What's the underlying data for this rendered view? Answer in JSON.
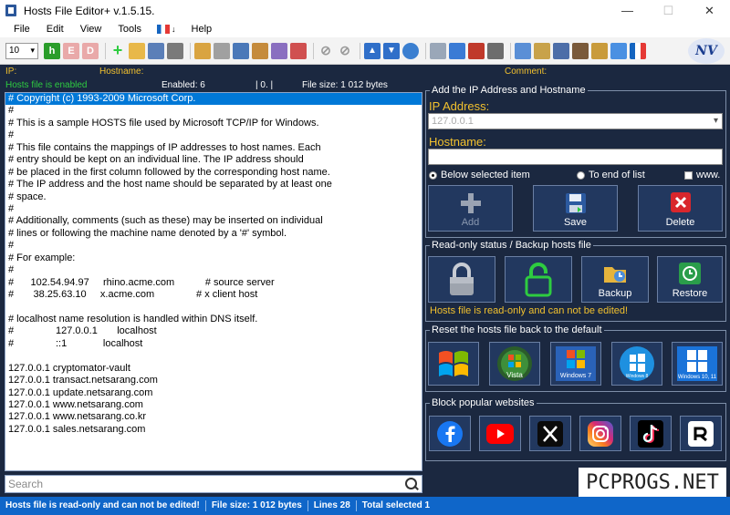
{
  "window": {
    "title": "Hosts File Editor+ v.1.5.15.",
    "min": "—",
    "max": "☐",
    "close": "✕"
  },
  "menu": [
    "File",
    "Edit",
    "View",
    "Tools",
    "Help"
  ],
  "toolbar": {
    "font_size": "10",
    "logo_text": "NV"
  },
  "columns": {
    "ip": "IP:",
    "hostname": "Hostname:",
    "comment": "Comment:"
  },
  "strip": {
    "state": "Hosts file is enabled",
    "enabled": "Enabled: 6",
    "zero": "| 0. |",
    "filesize": "File size: 1 012 bytes"
  },
  "editor_lines": [
    "# Copyright (c) 1993-2009 Microsoft Corp.",
    "#",
    "# This is a sample HOSTS file used by Microsoft TCP/IP for Windows.",
    "#",
    "# This file contains the mappings of IP addresses to host names. Each",
    "# entry should be kept on an individual line. The IP address should",
    "# be placed in the first column followed by the corresponding host name.",
    "# The IP address and the host name should be separated by at least one",
    "# space.",
    "#",
    "# Additionally, comments (such as these) may be inserted on individual",
    "# lines or following the machine name denoted by a '#' symbol.",
    "#",
    "# For example:",
    "#",
    "#      102.54.94.97     rhino.acme.com           # source server",
    "#       38.25.63.10     x.acme.com               # x client host",
    "",
    "# localhost name resolution is handled within DNS itself.",
    "#               127.0.0.1       localhost",
    "#               ::1             localhost",
    "",
    "127.0.0.1 cryptomator-vault",
    "127.0.0.1 transact.netsarang.com",
    "127.0.0.1 update.netsarang.com",
    "127.0.0.1 www.netsarang.com",
    "127.0.0.1 www.netsarang.co.kr",
    "127.0.0.1 sales.netsarang.com"
  ],
  "search": {
    "placeholder": "Search"
  },
  "add_panel": {
    "title": "Add the IP Address  and Hostname",
    "ip_label": "IP Address:",
    "ip_value": "127.0.0.1",
    "host_label": "Hostname:",
    "host_value": "",
    "radio_below": "Below selected item",
    "radio_end": "To end of list",
    "www_label": "www.",
    "add": "Add",
    "save": "Save",
    "delete": "Delete"
  },
  "ro_panel": {
    "title": "Read-only status / Backup hosts file",
    "backup": "Backup",
    "restore": "Restore",
    "message": "Hosts file is read-only and can not be edited!"
  },
  "reset_panel": {
    "title": "Reset the hosts file back to the default",
    "os": [
      "Windows XP",
      "Windows Vista",
      "Windows 7",
      "Windows 8",
      "Windows 10, 11"
    ],
    "labels": {
      "vista": "Vista",
      "w7": "Windows 7",
      "w8": "Windows 8",
      "w10": "Windows 10, 11"
    }
  },
  "block_panel": {
    "title": "Block popular websites",
    "sites": [
      "Facebook",
      "YouTube",
      "X",
      "Instagram",
      "TikTok",
      "Rumble"
    ]
  },
  "statusbar": {
    "msg": "Hosts file is read-only and can not be edited!",
    "filesize": "File size:  1 012 bytes",
    "lines": "Lines 28",
    "total": "Total selected 1"
  },
  "watermark": "PCPROGS.NET",
  "colors": {
    "bg": "#1b2840",
    "accent_yellow": "#f2c12e",
    "green": "#2ecc40",
    "status_blue": "#0f66c9"
  }
}
